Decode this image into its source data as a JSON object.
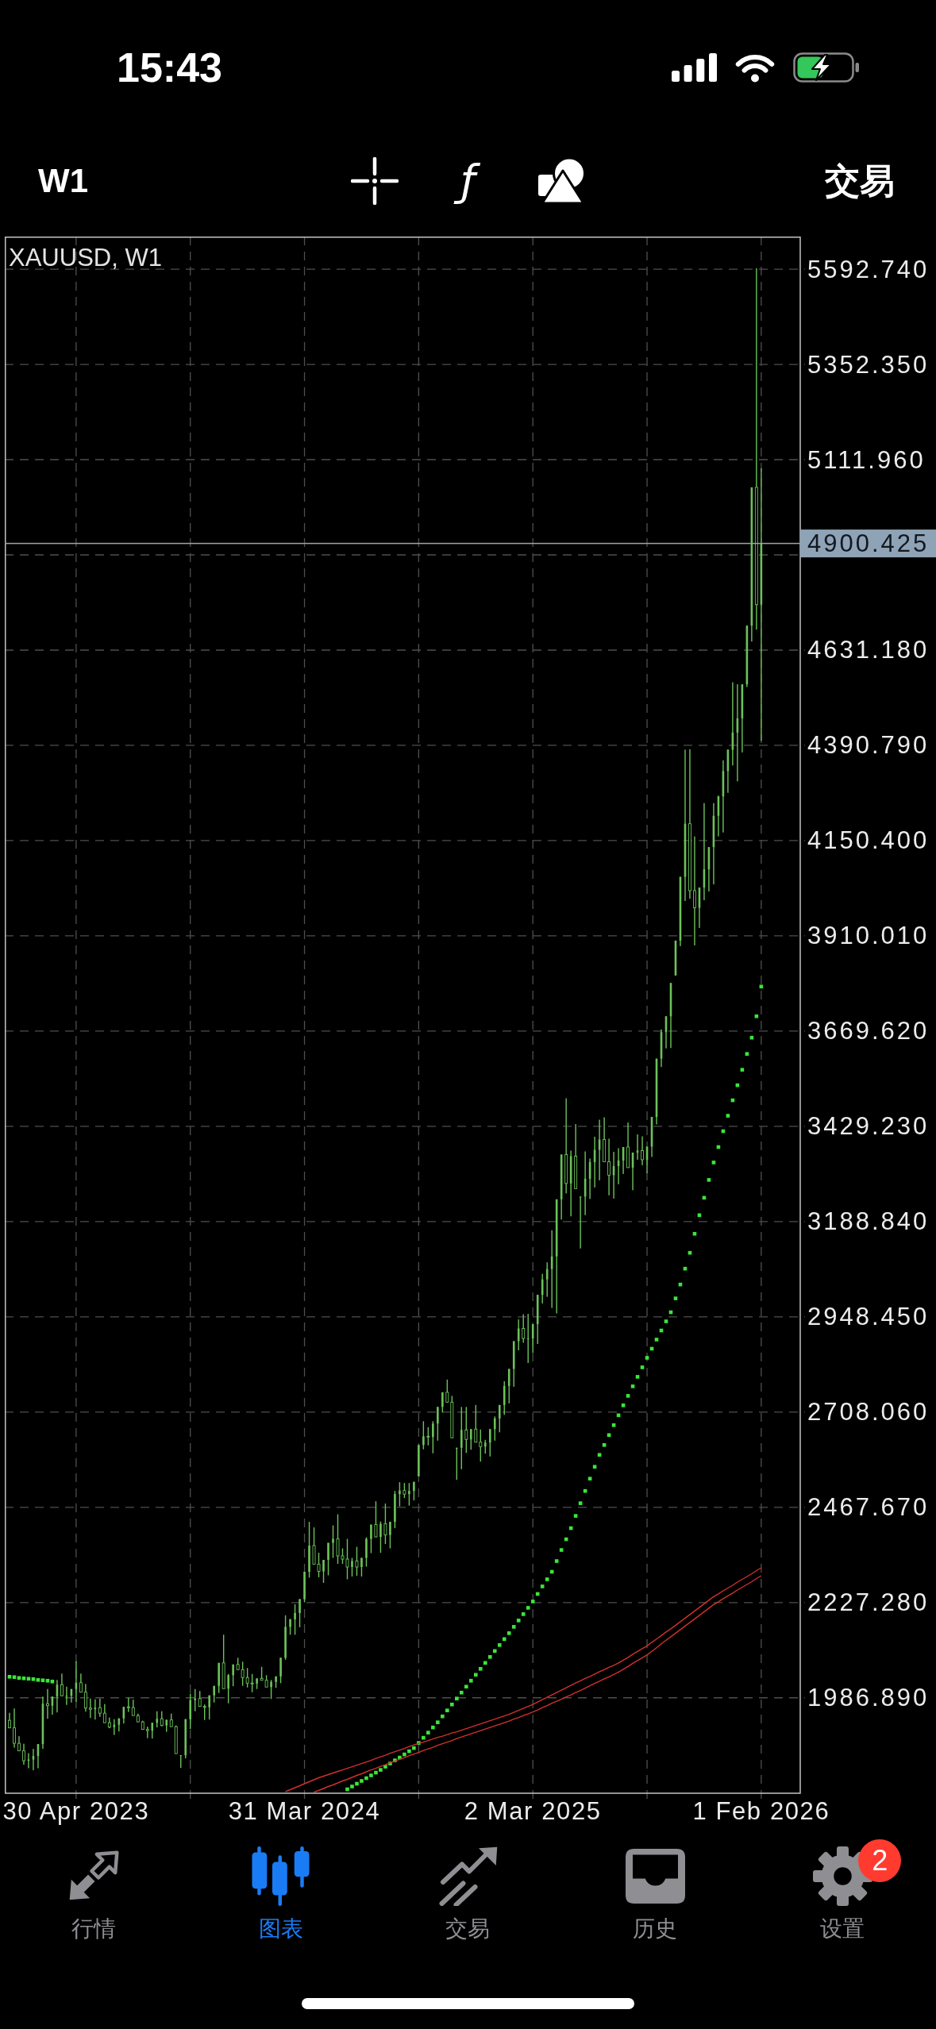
{
  "status_bar": {
    "time": "15:43"
  },
  "toolbar": {
    "period": "W1",
    "indicator_glyph": "ƒ",
    "trade": "交易"
  },
  "chart": {
    "title": "XAUUSD, W1",
    "chart_data": {
      "type": "candlestick",
      "grid": true,
      "categories": [
        null,
        null,
        null,
        null,
        null,
        null,
        null,
        null,
        null,
        null,
        null,
        null,
        null,
        null,
        "30 Apr 2023",
        null,
        null,
        null,
        null,
        null,
        null,
        null,
        null,
        null,
        null,
        null,
        null,
        null,
        null,
        null,
        null,
        null,
        null,
        null,
        null,
        null,
        null,
        null,
        null,
        null,
        null,
        null,
        null,
        null,
        null,
        null,
        null,
        null,
        null,
        null,
        null,
        null,
        null,
        null,
        null,
        null,
        null,
        null,
        null,
        null,
        null,
        null,
        "31 Mar 2024",
        null,
        null,
        null,
        null,
        null,
        null,
        null,
        null,
        null,
        null,
        null,
        null,
        null,
        null,
        null,
        null,
        null,
        null,
        null,
        null,
        null,
        null,
        null,
        null,
        null,
        null,
        null,
        null,
        null,
        null,
        null,
        null,
        null,
        null,
        null,
        null,
        null,
        null,
        null,
        null,
        null,
        null,
        null,
        null,
        null,
        null,
        null,
        "2 Mar 2025",
        null,
        null,
        null,
        null,
        null,
        null,
        null,
        null,
        null,
        null,
        null,
        null,
        null,
        null,
        null,
        null,
        null,
        null,
        null,
        null,
        null,
        null,
        null,
        null,
        null,
        null,
        null,
        null,
        null,
        null,
        null,
        null,
        null,
        null,
        null,
        null,
        null,
        null,
        null,
        null,
        null,
        null,
        null,
        null,
        null,
        null,
        null,
        "1 Feb 2026"
      ],
      "ylim": [
        1746,
        5675
      ],
      "yticks": [
        {
          "value": 5592.74,
          "label": "5592.740"
        },
        {
          "value": 5352.35,
          "label": "5352.350"
        },
        {
          "value": 5111.96,
          "label": "5111.960"
        },
        {
          "value": 4631.18,
          "label": "4631.180"
        },
        {
          "value": 4390.79,
          "label": "4390.790"
        },
        {
          "value": 4150.4,
          "label": "4150.400"
        },
        {
          "value": 3910.01,
          "label": "3910.010"
        },
        {
          "value": 3669.62,
          "label": "3669.620"
        },
        {
          "value": 3429.23,
          "label": "3429.230"
        },
        {
          "value": 3188.84,
          "label": "3188.840"
        },
        {
          "value": 2948.45,
          "label": "2948.450"
        },
        {
          "value": 2708.06,
          "label": "2708.060"
        },
        {
          "value": 2467.67,
          "label": "2467.670"
        },
        {
          "value": 2227.28,
          "label": "2227.280"
        },
        {
          "value": 1986.89,
          "label": "1986.890"
        }
      ],
      "series": [
        {
          "color": "#6cc25a",
          "ohlc": [
            [
              1930,
              1949,
              1911,
              1911
            ],
            [
              1911,
              1960,
              1861,
              1872
            ],
            [
              1872,
              1890,
              1853,
              1853
            ],
            [
              1853,
              1871,
              1818,
              1828
            ],
            [
              1828,
              1847,
              1809,
              1831
            ],
            [
              1831,
              1858,
              1804,
              1840
            ],
            [
              1840,
              1870,
              1809,
              1870
            ],
            [
              1870,
              1990,
              1858,
              1972
            ],
            [
              1972,
              2009,
              1934,
              1967
            ],
            [
              1967,
              1990,
              1944,
              1990
            ],
            [
              1990,
              2032,
              1950,
              2020
            ],
            [
              2020,
              2048,
              1991,
              1992
            ],
            [
              1992,
              2015,
              1969,
              1992
            ],
            [
              1992,
              2009,
              1975,
              2009
            ],
            [
              2009,
              2079,
              1977,
              2025
            ],
            [
              2025,
              2048,
              2001,
              2001
            ],
            [
              2001,
              2022,
              1952,
              1961
            ],
            [
              1961,
              1985,
              1936,
              1958
            ],
            [
              1958,
              1983,
              1932,
              1962
            ],
            [
              1962,
              1985,
              1939,
              1948
            ],
            [
              1948,
              1971,
              1924,
              1924
            ],
            [
              1924,
              1937,
              1910,
              1913
            ],
            [
              1913,
              1933,
              1893,
              1919
            ],
            [
              1919,
              1935,
              1902,
              1935
            ],
            [
              1935,
              1964,
              1922,
              1964
            ],
            [
              1964,
              1987,
              1951,
              1962
            ],
            [
              1962,
              1982,
              1942,
              1942
            ],
            [
              1942,
              1947,
              1926,
              1926
            ],
            [
              1926,
              1929,
              1907,
              1907
            ],
            [
              1907,
              1914,
              1885,
              1904
            ],
            [
              1904,
              1924,
              1884,
              1924
            ],
            [
              1924,
              1953,
              1912,
              1934
            ],
            [
              1934,
              1953,
              1915,
              1917
            ],
            [
              1917,
              1932,
              1901,
              1931
            ],
            [
              1931,
              1947,
              1914,
              1914
            ],
            [
              1914,
              1917,
              1846,
              1846
            ],
            [
              1842,
              1842,
              1810,
              1842
            ],
            [
              1842,
              1933,
              1834,
              1933
            ],
            [
              1933,
              1997,
              1908,
              1981
            ],
            [
              1981,
              2009,
              1953,
              1985
            ],
            [
              1985,
              2004,
              1965,
              1965
            ],
            [
              1965,
              1970,
              1931,
              1963
            ],
            [
              1963,
              1993,
              1932,
              1993
            ],
            [
              1993,
              2017,
              1975,
              2017
            ],
            [
              2017,
              2075,
              1999,
              2075
            ],
            [
              2075,
              2146,
              2010,
              2010
            ],
            [
              2010,
              2047,
              1973,
              2044
            ],
            [
              2044,
              2071,
              2016,
              2071
            ],
            [
              2071,
              2088,
              2058,
              2058
            ],
            [
              2058,
              2078,
              2017,
              2038
            ],
            [
              2038,
              2062,
              2013,
              2024
            ],
            [
              2024,
              2047,
              2001,
              2023
            ],
            [
              2023,
              2036,
              2009,
              2036
            ],
            [
              2036,
              2065,
              2031,
              2031
            ],
            [
              2031,
              2044,
              2014,
              2014
            ],
            [
              2014,
              2032,
              1984,
              2027
            ],
            [
              2027,
              2041,
              2012,
              2041
            ],
            [
              2041,
              2088,
              2024,
              2088
            ],
            [
              2088,
              2195,
              2083,
              2166
            ],
            [
              2166,
              2186,
              2146,
              2185
            ],
            [
              2185,
              2223,
              2146,
              2201
            ],
            [
              2201,
              2236,
              2165,
              2236
            ],
            [
              2236,
              2305,
              2229,
              2305
            ],
            [
              2305,
              2431,
              2290,
              2371
            ],
            [
              2371,
              2417,
              2324,
              2324
            ],
            [
              2324,
              2353,
              2291,
              2306
            ],
            [
              2306,
              2335,
              2277,
              2335
            ],
            [
              2335,
              2378,
              2296,
              2378
            ],
            [
              2378,
              2422,
              2340,
              2388
            ],
            [
              2388,
              2450,
              2325,
              2345
            ],
            [
              2345,
              2364,
              2325,
              2337
            ],
            [
              2337,
              2388,
              2286,
              2317
            ],
            [
              2317,
              2340,
              2293,
              2332
            ],
            [
              2332,
              2368,
              2295,
              2317
            ],
            [
              2317,
              2340,
              2293,
              2340
            ],
            [
              2340,
              2392,
              2318,
              2388
            ],
            [
              2388,
              2424,
              2352,
              2424
            ],
            [
              2424,
              2483,
              2392,
              2393
            ],
            [
              2393,
              2432,
              2353,
              2426
            ],
            [
              2426,
              2477,
              2375,
              2398
            ],
            [
              2398,
              2431,
              2364,
              2431
            ],
            [
              2431,
              2509,
              2415,
              2501
            ],
            [
              2501,
              2531,
              2470,
              2510
            ],
            [
              2510,
              2529,
              2491,
              2501
            ],
            [
              2501,
              2529,
              2472,
              2509
            ],
            [
              2509,
              2532,
              2485,
              2532
            ],
            [
              2546,
              2625,
              2546,
              2625
            ],
            [
              2625,
              2685,
              2614,
              2647
            ],
            [
              2647,
              2670,
              2624,
              2645
            ],
            [
              2645,
              2685,
              2604,
              2679
            ],
            [
              2679,
              2721,
              2636,
              2721
            ],
            [
              2721,
              2758,
              2707,
              2758
            ],
            [
              2758,
              2790,
              2733,
              2733
            ],
            [
              2733,
              2749,
              2643,
              2643
            ],
            [
              2618,
              2618,
              2537,
              2618
            ],
            [
              2618,
              2721,
              2564,
              2663
            ],
            [
              2663,
              2721,
              2605,
              2639
            ],
            [
              2639,
              2665,
              2613,
              2665
            ],
            [
              2665,
              2726,
              2632,
              2632
            ],
            [
              2632,
              2664,
              2583,
              2621
            ],
            [
              2621,
              2638,
              2603,
              2631
            ],
            [
              2631,
              2665,
              2596,
              2665
            ],
            [
              2665,
              2697,
              2636,
              2692
            ],
            [
              2692,
              2726,
              2657,
              2726
            ],
            [
              2726,
              2786,
              2701,
              2774
            ],
            [
              2774,
              2817,
              2730,
              2817
            ],
            [
              2817,
              2887,
              2772,
              2887
            ],
            [
              2887,
              2942,
              2864,
              2919
            ],
            [
              2919,
              2955,
              2883,
              2894
            ],
            [
              2894,
              2956,
              2832,
              2894
            ],
            [
              2894,
              2930,
              2858,
              2930
            ],
            [
              2930,
              3004,
              2880,
              3004
            ],
            [
              3004,
              3057,
              2982,
              3043
            ],
            [
              3043,
              3086,
              2999,
              3069
            ],
            [
              3069,
              3167,
              2971,
              3101
            ],
            [
              3101,
              3245,
              2957,
              3245
            ],
            [
              3245,
              3358,
              3194,
              3358
            ],
            [
              3358,
              3500,
              3260,
              3285
            ],
            [
              3285,
              3368,
              3202,
              3354
            ],
            [
              3354,
              3435,
              3272,
              3272
            ],
            [
              3252,
              3252,
              3121,
              3252
            ],
            [
              3252,
              3366,
              3205,
              3297
            ],
            [
              3297,
              3348,
              3246,
              3339
            ],
            [
              3339,
              3403,
              3275,
              3370
            ],
            [
              3370,
              3446,
              3293,
              3396
            ],
            [
              3396,
              3452,
              3340,
              3340
            ],
            [
              3340,
              3398,
              3255,
              3306
            ],
            [
              3306,
              3365,
              3247,
              3329
            ],
            [
              3329,
              3374,
              3283,
              3343
            ],
            [
              3343,
              3377,
              3309,
              3377
            ],
            [
              3377,
              3439,
              3325,
              3325
            ],
            [
              3325,
              3363,
              3268,
              3363
            ],
            [
              3363,
              3409,
              3345,
              3368
            ],
            [
              3368,
              3404,
              3331,
              3345
            ],
            [
              3345,
              3378,
              3311,
              3378
            ],
            [
              3378,
              3453,
              3352,
              3453
            ],
            [
              3453,
              3600,
              3434,
              3600
            ],
            [
              3600,
              3674,
              3579,
              3667
            ],
            [
              3667,
              3707,
              3626,
              3707
            ],
            [
              3707,
              3791,
              3627,
              3791
            ],
            [
              3810,
              3898,
              3810,
              3898
            ],
            [
              3898,
              4059,
              3884,
              4059
            ],
            [
              4059,
              4380,
              3998,
              4193
            ],
            [
              4193,
              4381,
              4004,
              4024
            ],
            [
              4024,
              4161,
              3886,
              3981
            ],
            [
              3981,
              4032,
              3930,
              4032
            ],
            [
              4032,
              4245,
              4000,
              4078
            ],
            [
              4078,
              4134,
              4022,
              4134
            ],
            [
              4134,
              4245,
              4040,
              4213
            ],
            [
              4213,
              4264,
              4161,
              4262
            ],
            [
              4262,
              4353,
              4171,
              4326
            ],
            [
              4326,
              4380,
              4271,
              4380
            ],
            [
              4380,
              4550,
              4340,
              4423
            ],
            [
              4423,
              4545,
              4300,
              4459
            ],
            [
              4459,
              4545,
              4373,
              4545
            ],
            [
              4545,
              4693,
              4538,
              4693
            ],
            [
              4693,
              5042,
              4653,
              5042
            ],
            [
              5042,
              5595,
              4683,
              4746
            ],
            [
              4746,
              5090,
              4402,
              4900
            ]
          ]
        },
        {
          "type": "scatter",
          "color": "#3ae63a",
          "values": [
            2040,
            2039,
            2037,
            2036,
            2035,
            2034,
            2032,
            2031,
            2030,
            2028,
            null,
            null,
            null,
            null,
            null,
            null,
            null,
            null,
            null,
            null,
            null,
            null,
            null,
            null,
            null,
            null,
            null,
            null,
            null,
            null,
            null,
            null,
            null,
            null,
            null,
            null,
            null,
            null,
            null,
            null,
            null,
            null,
            null,
            null,
            null,
            null,
            null,
            null,
            null,
            null,
            null,
            null,
            null,
            null,
            null,
            null,
            null,
            null,
            null,
            null,
            null,
            null,
            null,
            null,
            null,
            null,
            null,
            null,
            null,
            null,
            null,
            1756,
            1763,
            1770,
            1777,
            1784,
            1791,
            1798,
            1805,
            1813,
            1821,
            1829,
            1836,
            1844,
            1852,
            1860,
            1873,
            1886,
            1899,
            1912,
            1925,
            1940,
            1955,
            1970,
            1985,
            2000,
            2015,
            2030,
            2045,
            2060,
            2075,
            2090,
            2105,
            2120,
            2135,
            2150,
            2166,
            2182,
            2198,
            2214,
            2230,
            2249,
            2268,
            2286,
            2305,
            2332,
            2360,
            2387,
            2415,
            2446,
            2478,
            2509,
            2540,
            2570,
            2600,
            2625,
            2650,
            2675,
            2700,
            2725,
            2749,
            2773,
            2797,
            2821,
            2845,
            2868,
            2891,
            2914,
            2937,
            2960,
            2995,
            3030,
            3070,
            3110,
            3158,
            3205,
            3249,
            3294,
            3338,
            3377,
            3417,
            3456,
            3495,
            3533,
            3572,
            3612,
            3653,
            3707,
            3782
          ]
        },
        {
          "type": "line",
          "color": "#d0312d",
          "values": [
            null,
            null,
            null,
            null,
            null,
            null,
            null,
            null,
            null,
            null,
            null,
            null,
            null,
            null,
            null,
            null,
            null,
            null,
            null,
            null,
            null,
            null,
            null,
            null,
            null,
            null,
            null,
            null,
            null,
            null,
            null,
            null,
            null,
            null,
            null,
            null,
            null,
            null,
            null,
            null,
            null,
            null,
            null,
            null,
            null,
            null,
            null,
            null,
            null,
            null,
            null,
            null,
            null,
            null,
            null,
            null,
            null,
            null,
            1750,
            1755,
            1760,
            1765,
            1770,
            1775,
            1780,
            1785,
            1789,
            1793,
            1797,
            1801,
            1805,
            1809,
            1813,
            1817,
            1821,
            1825,
            1829,
            1834,
            1838,
            1842,
            1847,
            1851,
            1855,
            1859,
            1864,
            1868,
            1872,
            1875,
            1879,
            1883,
            1887,
            1890,
            1894,
            1898,
            1901,
            1905,
            1909,
            1913,
            1917,
            1921,
            1925,
            1929,
            1933,
            1937,
            1941,
            1945,
            1950,
            1955,
            1960,
            1965,
            1970,
            1976,
            1982,
            1988,
            1994,
            2000,
            2006,
            2012,
            2018,
            2024,
            2030,
            2036,
            2041,
            2047,
            2053,
            2058,
            2064,
            2069,
            2075,
            2082,
            2089,
            2097,
            2104,
            2111,
            2118,
            2127,
            2135,
            2144,
            2153,
            2161,
            2170,
            2179,
            2188,
            2197,
            2206,
            2215,
            2224,
            2233,
            2242,
            2249,
            2257,
            2264,
            2271,
            2279,
            2286,
            2293,
            2300,
            2308,
            2315
          ]
        },
        {
          "type": "line",
          "color": "#d0312d",
          "values": [
            null,
            null,
            null,
            null,
            null,
            null,
            null,
            null,
            null,
            null,
            null,
            null,
            null,
            null,
            null,
            null,
            null,
            null,
            null,
            null,
            null,
            null,
            null,
            null,
            null,
            null,
            null,
            null,
            null,
            null,
            null,
            null,
            null,
            null,
            null,
            null,
            null,
            null,
            null,
            null,
            null,
            null,
            null,
            null,
            null,
            null,
            null,
            null,
            null,
            null,
            null,
            null,
            null,
            null,
            null,
            null,
            null,
            null,
            null,
            null,
            null,
            null,
            null,
            null,
            1749,
            1753,
            1758,
            1763,
            1767,
            1772,
            1777,
            1781,
            1786,
            1791,
            1795,
            1800,
            1805,
            1809,
            1814,
            1818,
            1823,
            1827,
            1832,
            1836,
            1841,
            1845,
            1849,
            1854,
            1858,
            1862,
            1867,
            1871,
            1875,
            1879,
            1884,
            1888,
            1892,
            1896,
            1900,
            1904,
            1908,
            1912,
            1916,
            1920,
            1924,
            1928,
            1933,
            1937,
            1942,
            1946,
            1951,
            1956,
            1962,
            1967,
            1973,
            1978,
            1983,
            1989,
            1994,
            2000,
            2005,
            2011,
            2017,
            2023,
            2029,
            2035,
            2040,
            2046,
            2052,
            2059,
            2066,
            2074,
            2081,
            2088,
            2095,
            2104,
            2113,
            2123,
            2132,
            2141,
            2150,
            2159,
            2168,
            2177,
            2186,
            2195,
            2204,
            2213,
            2222,
            2229,
            2237,
            2244,
            2251,
            2259,
            2266,
            2273,
            2280,
            2288,
            2295
          ]
        }
      ],
      "ref_lines": [
        {
          "axis": "y",
          "value": 4900.425,
          "label": "4900.425"
        }
      ]
    }
  },
  "tab_bar": {
    "items": [
      {
        "kind": "quotes",
        "label": "行情",
        "selected": false
      },
      {
        "kind": "chart",
        "label": "图表",
        "selected": true
      },
      {
        "kind": "trade",
        "label": "交易",
        "selected": false
      },
      {
        "kind": "history",
        "label": "历史",
        "selected": false
      },
      {
        "kind": "settings",
        "label": "设置",
        "selected": false,
        "badge": "2"
      }
    ]
  }
}
